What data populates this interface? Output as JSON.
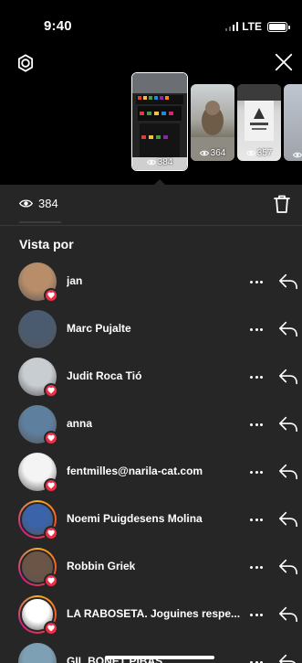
{
  "status": {
    "time": "9:40",
    "network": "LTE",
    "battery": 1.0
  },
  "stories": [
    {
      "views": "384",
      "active": true
    },
    {
      "views": "364",
      "active": false
    },
    {
      "views": "357",
      "active": false
    },
    {
      "views": "",
      "active": false
    }
  ],
  "viewers_count": "384",
  "section_title": "Vista por",
  "viewers": [
    {
      "name": "jan",
      "liked": true,
      "ring": false,
      "avatar_color": "#b78d6a"
    },
    {
      "name": "Marc Pujalte",
      "liked": false,
      "ring": false,
      "avatar_color": "#4a5b6f"
    },
    {
      "name": "Judit Roca Tió",
      "liked": true,
      "ring": false,
      "avatar_color": "#c8cdd2"
    },
    {
      "name": "anna",
      "liked": true,
      "ring": false,
      "avatar_color": "#5f7f9f"
    },
    {
      "name": "fentmilles@narila-cat.com",
      "liked": true,
      "ring": false,
      "avatar_color": "#f4f4f4"
    },
    {
      "name": "Noemi Puigdesens Molina",
      "liked": true,
      "ring": true,
      "avatar_color": "#3a63a9"
    },
    {
      "name": "Robbin Griek",
      "liked": true,
      "ring": true,
      "avatar_color": "#6a5546"
    },
    {
      "name": "LA RABOSETA. Joguines respe...",
      "liked": true,
      "ring": true,
      "avatar_color": "#ffffff"
    },
    {
      "name": "GIL BONET PIBAS",
      "liked": false,
      "ring": false,
      "avatar_color": "#7ea0b4"
    }
  ],
  "colors": {
    "sheet_bg": "#262626",
    "heart": "#ed2f48",
    "ring_start": "#f9b020",
    "ring_end": "#c9208b"
  },
  "icons": {
    "settings": "settings-icon",
    "close": "close-icon",
    "eye": "eye-icon",
    "trash": "trash-icon",
    "more": "more-icon",
    "reply": "reply-icon",
    "heart": "heart-icon"
  }
}
